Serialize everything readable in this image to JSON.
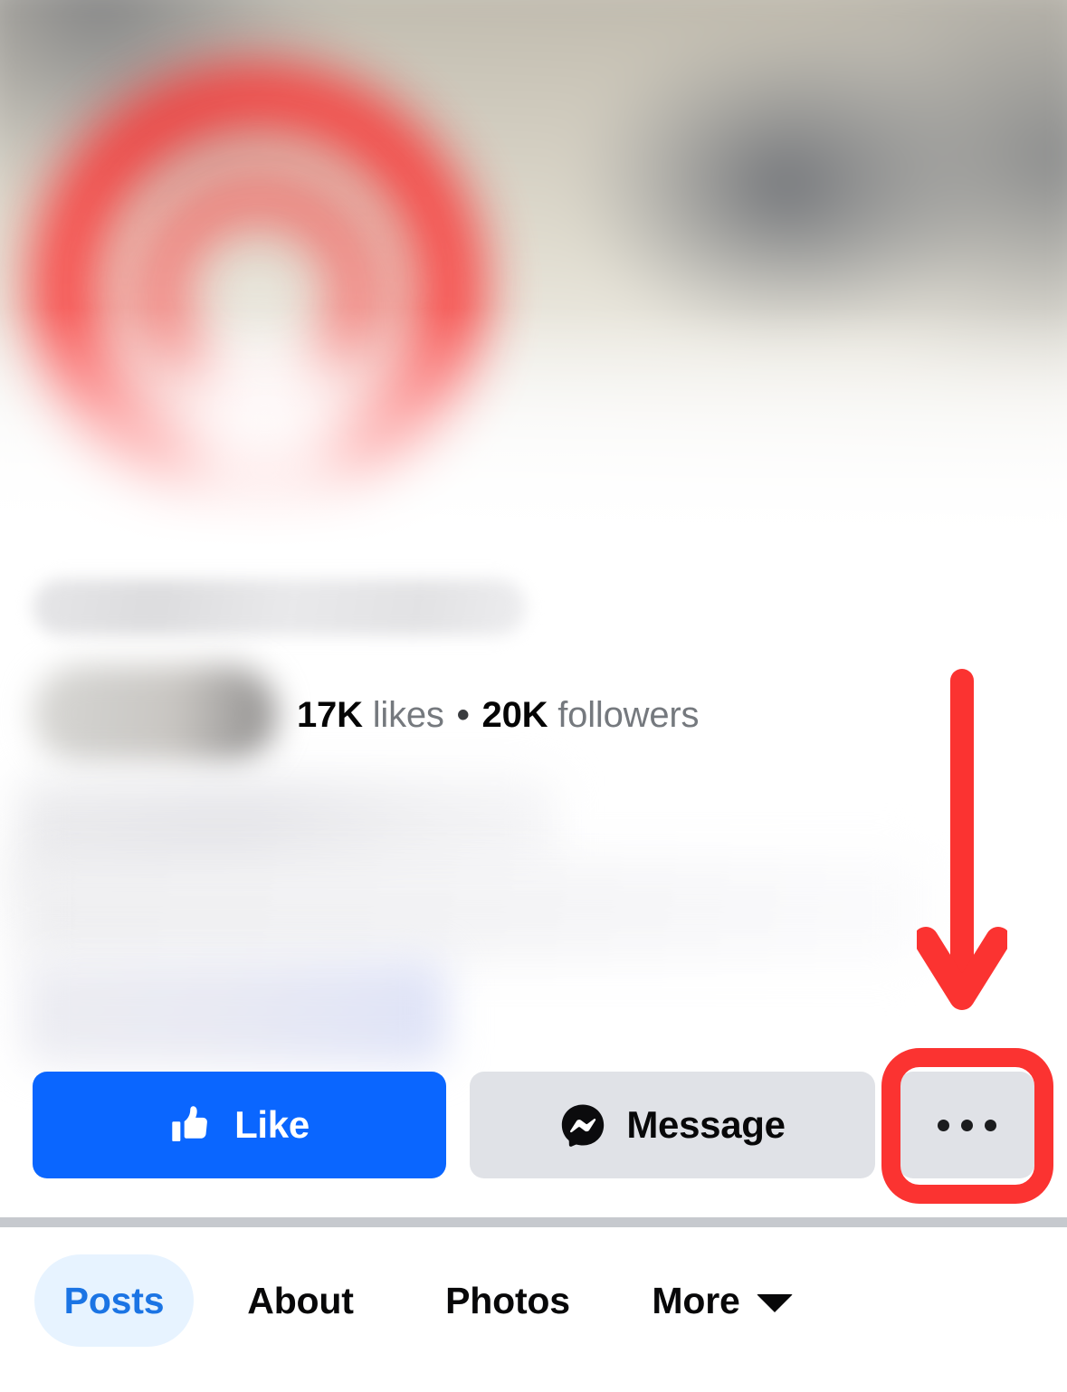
{
  "page": {
    "platform": "facebook-page-profile",
    "cover_image": "blurred-cover-photo",
    "profile_logo": "blurred-red-circular-logo",
    "page_name": "blurred-page-name",
    "page_category": "blurred-page-category",
    "page_description": "blurred-page-description"
  },
  "stats": {
    "likes_count": "17K",
    "likes_label": "likes",
    "separator": "•",
    "followers_count": "20K",
    "followers_label": "followers"
  },
  "actions": {
    "like": {
      "label": "Like",
      "icon": "thumbs-up-icon"
    },
    "message": {
      "label": "Message",
      "icon": "messenger-icon"
    },
    "more": {
      "label": "",
      "icon": "ellipsis-icon"
    }
  },
  "tabs": [
    {
      "label": "Posts",
      "active": true,
      "icon": null
    },
    {
      "label": "About",
      "active": false,
      "icon": null
    },
    {
      "label": "Photos",
      "active": false,
      "icon": null
    },
    {
      "label": "More",
      "active": false,
      "icon": "caret-down-icon"
    }
  ],
  "annotations": {
    "arrow": {
      "icon": "down-arrow-annotation",
      "points_to": "more-options-button"
    },
    "highlight_box": {
      "icon": "rounded-rect-highlight",
      "target": "more-options-button"
    }
  },
  "colors": {
    "brand_blue": "#0A66FF",
    "tab_active_text": "#1B74E4",
    "tab_active_bg": "#E7F3FF",
    "button_gray": "#E0E2E7",
    "annotation_red": "#FB3331",
    "text_primary": "#050505",
    "text_secondary": "#75797E",
    "divider": "#C6C9CE"
  }
}
